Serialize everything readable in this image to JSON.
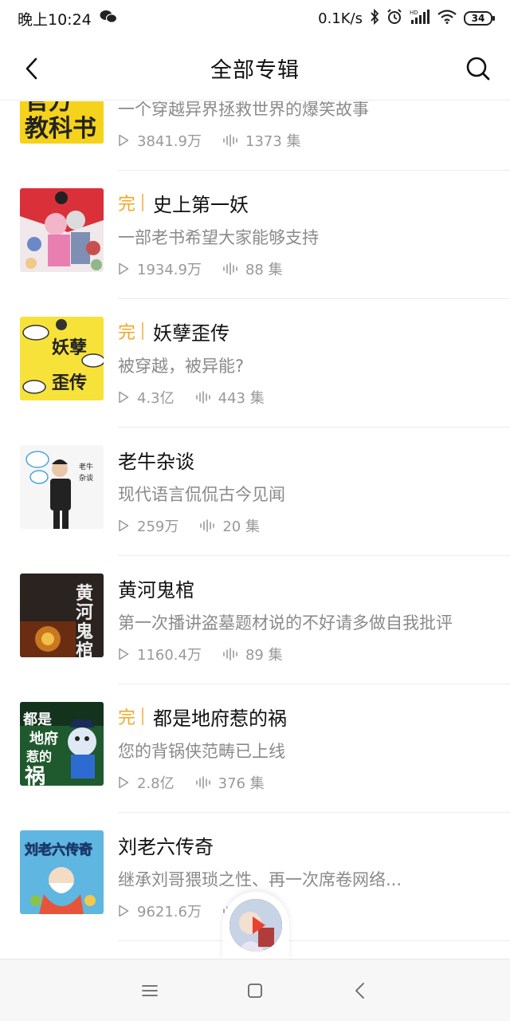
{
  "status_bar": {
    "time": "晚上10:24",
    "network_speed": "0.1K/s",
    "battery": "34",
    "icons": [
      "wechat-icon",
      "bluetooth-icon",
      "alarm-icon",
      "hd-signal-icon",
      "wifi-icon",
      "battery-icon"
    ]
  },
  "header": {
    "title": "全部专辑",
    "back_icon": "back-chevron-icon",
    "search_icon": "search-icon"
  },
  "albums": [
    {
      "badge": "",
      "title": "",
      "desc": "一个穿越异界拯救世界的爆笑故事",
      "plays": "3841.9万",
      "episodes": "1373 集",
      "cover_text": "官方教科书",
      "cover_color": "#f5d21c"
    },
    {
      "badge": "完",
      "title": "史上第一妖",
      "desc": "一部老书希望大家能够支持",
      "plays": "1934.9万",
      "episodes": "88 集",
      "cover_text": "",
      "cover_color": "#d9303a"
    },
    {
      "badge": "完",
      "title": "妖孽歪传",
      "desc": "被穿越，被异能?",
      "plays": "4.3亿",
      "episodes": "443 集",
      "cover_text": "妖孽歪传",
      "cover_color": "#f7e23a"
    },
    {
      "badge": "",
      "title": "老牛杂谈",
      "desc": "现代语言侃侃古今见闻",
      "plays": "259万",
      "episodes": "20 集",
      "cover_text": "老牛杂谈",
      "cover_color": "#f4f4f4"
    },
    {
      "badge": "",
      "title": "黄河鬼棺",
      "desc": "第一次播讲盗墓题材说的不好请多做自我批评",
      "plays": "1160.4万",
      "episodes": "89 集",
      "cover_text": "黄河鬼棺",
      "cover_color": "#2b2320"
    },
    {
      "badge": "完",
      "title": "都是地府惹的祸",
      "desc": "您的背锅侠范畴已上线",
      "plays": "2.8亿",
      "episodes": "376 集",
      "cover_text": "都是地府惹的祸",
      "cover_color": "#1f5a2e"
    },
    {
      "badge": "",
      "title": "刘老六传奇",
      "desc": "继承刘哥猥琐之性、再一次席卷网络...",
      "plays": "9621.6万",
      "episodes": "集",
      "cover_text": "刘老六传奇",
      "cover_color": "#5fb6e0"
    }
  ],
  "nav_bar": {
    "icons": [
      "menu-icon",
      "home-square-icon",
      "back-triangle-icon"
    ]
  },
  "colors": {
    "accent": "#f5a623",
    "text_primary": "#111111",
    "text_secondary": "#8a8a8a",
    "divider": "#ececec"
  }
}
